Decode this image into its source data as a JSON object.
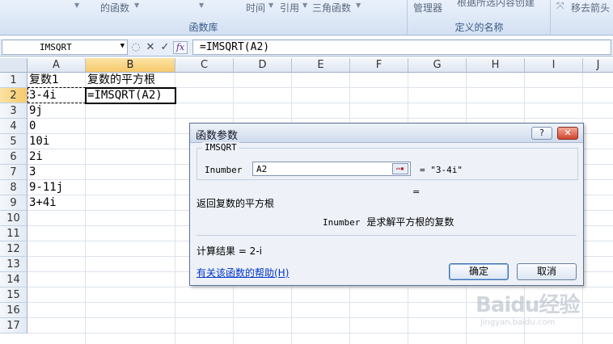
{
  "ribbon": {
    "item_functions": "的函数",
    "item_time": "时间",
    "item_reference": "引用",
    "item_trig": "三角函数",
    "item_manager": "管理器",
    "item_create": "根据所选内容创建",
    "item_remove_arrows": "移去箭头",
    "group_function_library": "函数库",
    "group_defined_names": "定义的名称"
  },
  "formula_bar": {
    "name_box": "IMSQRT",
    "formula": "=IMSQRT(A2)"
  },
  "sheet": {
    "columns": [
      "A",
      "B",
      "C",
      "D",
      "E",
      "F",
      "G",
      "H",
      "I",
      "J"
    ],
    "rows": [
      "1",
      "2",
      "3",
      "4",
      "5",
      "6",
      "7",
      "8",
      "9",
      "10",
      "11",
      "12",
      "13",
      "14",
      "15",
      "16",
      "17"
    ],
    "cells": {
      "A1": "复数1",
      "B1": "复数的平方根",
      "A2": "3-4i",
      "B2": "=IMSQRT(A2)",
      "A3": "9j",
      "A4": "0",
      "A5": "10i",
      "A6": "2i",
      "A7": "3",
      "A8": "9-11j",
      "A9": "3+4i"
    }
  },
  "dialog": {
    "title": "函数参数",
    "help_btn": "?",
    "close_btn": "✕",
    "function_name": "IMSQRT",
    "arg_label": "Inumber",
    "arg_value": "A2",
    "arg_result": "= \"3-4i\"",
    "equals_empty": "=",
    "description": "返回复数的平方根",
    "arg_desc_name": "Inumber",
    "arg_desc_text": "是求解平方根的复数",
    "result": "计算结果 = 2-i",
    "help_link": "有关该函数的帮助(H)",
    "ok": "确定",
    "cancel": "取消"
  },
  "watermark": {
    "logo": "Baidu经验",
    "url": "jingyan.baidu.com"
  }
}
